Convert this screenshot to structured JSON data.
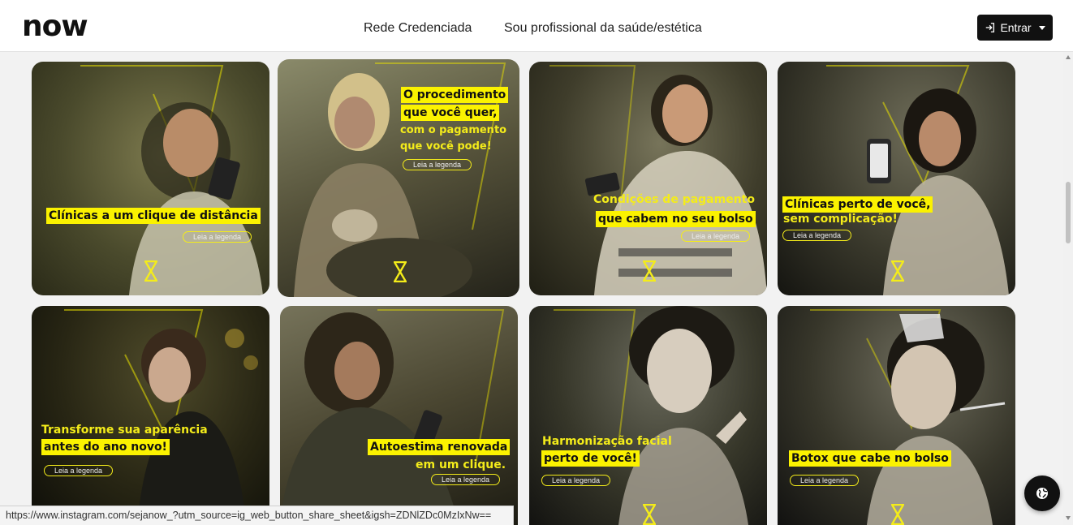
{
  "brand": {
    "logo_text": "now"
  },
  "nav": {
    "link_1": "Rede Credenciada",
    "link_2": "Sou profissional da saúde/estética",
    "login_label": "Entrar"
  },
  "colors": {
    "accent": "#fbf200",
    "dark": "#111111"
  },
  "cards": [
    {
      "line1": "Clínicas a um clique de distância",
      "line2": "",
      "pill": "Leia a legenda"
    },
    {
      "line1": "O procedimento",
      "line2": "que você quer,",
      "line3": "com o pagamento",
      "line4": "que você pode!",
      "pill": "Leia a legenda"
    },
    {
      "line1": "Condições de pagamento",
      "line2": "que cabem no seu bolso",
      "pill": "Leia a legenda"
    },
    {
      "line1": "Clínicas perto de você,",
      "line2": "sem complicação!",
      "pill": "Leia a legenda"
    },
    {
      "line1": "Transforme sua aparência",
      "line2": "antes do ano novo!",
      "pill": "Leia a legenda"
    },
    {
      "line1": "Autoestima renovada",
      "line2": "em um clique.",
      "pill": "Leia a legenda"
    },
    {
      "line1": "Harmonização facial",
      "line2": "perto de você!",
      "pill": "Leia a legenda"
    },
    {
      "line1": "Botox que cabe no bolso",
      "line2": "",
      "pill": "Leia a legenda"
    }
  ],
  "icons": {
    "login": "login-icon",
    "globe": "globe-icon",
    "hourglass": "hourglass-icon"
  },
  "status_bar": {
    "url": "https://www.instagram.com/sejanow_?utm_source=ig_web_button_share_sheet&igsh=ZDNlZDc0MzIxNw=="
  }
}
